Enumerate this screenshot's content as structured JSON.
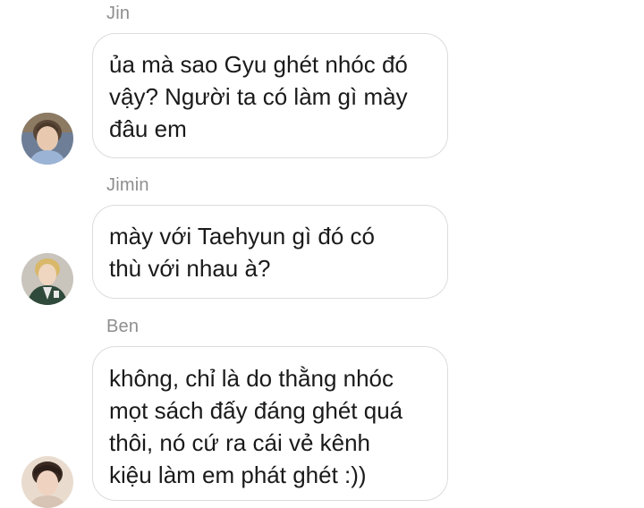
{
  "messages": [
    {
      "sender": "Jin",
      "lines": [
        "ủa mà sao Gyu ghét nhóc đó",
        "vậy? Người ta có làm gì mày",
        "đâu em"
      ],
      "avatar_icon": "user-avatar-photo"
    },
    {
      "sender": "Jimin",
      "lines": [
        "mày với Taehyun gì đó có",
        "thù với nhau à?"
      ],
      "avatar_icon": "user-avatar-photo"
    },
    {
      "sender": "Ben",
      "lines": [
        "không, chỉ là do thằng nhóc",
        "mọt sách đấy đáng ghét quá",
        "thôi, nó cứ ra cái vẻ kênh",
        "kiệu làm em phát ghét :))"
      ],
      "avatar_icon": "user-avatar-photo"
    }
  ],
  "colors": {
    "background": "#ffffff",
    "bubble_border": "#dcdcdc",
    "sender_name": "#8e8e8e",
    "message_text": "#1a1a1a"
  }
}
